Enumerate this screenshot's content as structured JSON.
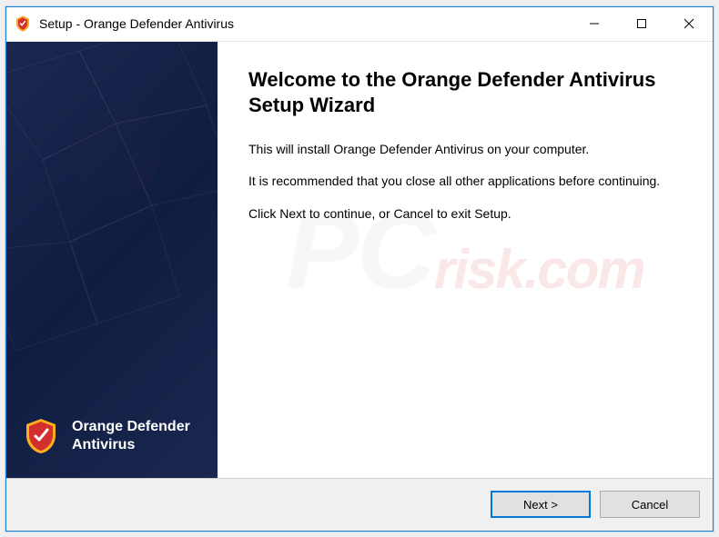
{
  "titlebar": {
    "text": "Setup - Orange Defender Antivirus"
  },
  "sidebar": {
    "product_name_line1": "Orange Defender",
    "product_name_line2": "Antivirus"
  },
  "main": {
    "heading": "Welcome to the Orange Defender Antivirus Setup Wizard",
    "para1": "This will install Orange Defender Antivirus on your computer.",
    "para2": "It is recommended that you close all other applications before continuing.",
    "para3": "Click Next to continue, or Cancel to exit Setup."
  },
  "buttons": {
    "next": "Next >",
    "cancel": "Cancel"
  }
}
